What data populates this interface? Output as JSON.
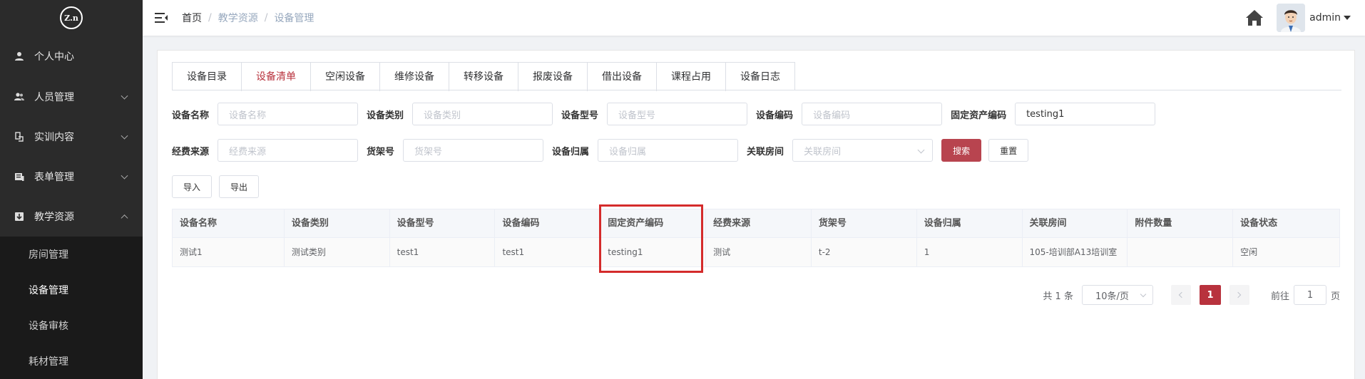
{
  "sidebar": {
    "logo_text": "Z.n",
    "items": [
      {
        "label": "个人中心",
        "icon": "user-icon"
      },
      {
        "label": "人员管理",
        "icon": "users-icon"
      },
      {
        "label": "实训内容",
        "icon": "book-icon"
      },
      {
        "label": "表单管理",
        "icon": "form-icon"
      },
      {
        "label": "教学资源",
        "icon": "resource-icon"
      }
    ],
    "subitems": [
      {
        "label": "房间管理"
      },
      {
        "label": "设备管理"
      },
      {
        "label": "设备审核"
      },
      {
        "label": "耗材管理"
      }
    ]
  },
  "header": {
    "breadcrumb": [
      "首页",
      "教学资源",
      "设备管理"
    ],
    "username": "admin"
  },
  "tabs": [
    "设备目录",
    "设备清单",
    "空闲设备",
    "维修设备",
    "转移设备",
    "报废设备",
    "借出设备",
    "课程占用",
    "设备日志"
  ],
  "filters": {
    "device_name": {
      "label": "设备名称",
      "placeholder": "设备名称",
      "value": ""
    },
    "device_type": {
      "label": "设备类别",
      "placeholder": "设备类别",
      "value": ""
    },
    "device_model": {
      "label": "设备型号",
      "placeholder": "设备型号",
      "value": ""
    },
    "device_code": {
      "label": "设备编码",
      "placeholder": "设备编码",
      "value": ""
    },
    "asset_code": {
      "label": "固定资产编码",
      "placeholder": "固定资产编码",
      "value": "testing1"
    },
    "fund_source": {
      "label": "经费来源",
      "placeholder": "经费来源",
      "value": ""
    },
    "shelf_no": {
      "label": "货架号",
      "placeholder": "货架号",
      "value": ""
    },
    "owner": {
      "label": "设备归属",
      "placeholder": "设备归属",
      "value": ""
    },
    "room": {
      "label": "关联房间",
      "placeholder": "关联房间",
      "value": ""
    },
    "search_btn": "搜索",
    "reset_btn": "重置",
    "import_btn": "导入",
    "export_btn": "导出"
  },
  "table": {
    "columns": [
      "设备名称",
      "设备类别",
      "设备型号",
      "设备编码",
      "固定资产编码",
      "经费来源",
      "货架号",
      "设备归属",
      "关联房间",
      "附件数量",
      "设备状态"
    ],
    "rows": [
      [
        "测试1",
        "测试类别",
        "test1",
        "test1",
        "testing1",
        "测试",
        "t-2",
        "1",
        "105-培训部A13培训室",
        "",
        "空闲"
      ]
    ]
  },
  "pagination": {
    "total_text": "共 1 条",
    "page_size": "10条/页",
    "current_page": "1",
    "goto_label": "前往",
    "goto_value": "1",
    "page_suffix": "页"
  },
  "colors": {
    "accent": "#b8323d",
    "sidebar_bg": "#2b2b2b",
    "highlight_box": "#d42b2b"
  }
}
